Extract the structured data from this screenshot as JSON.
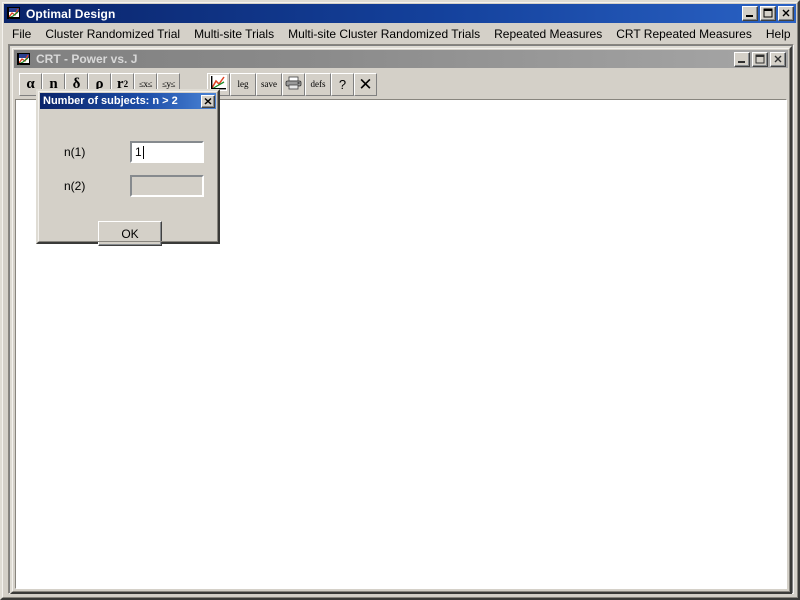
{
  "app": {
    "title": "Optimal Design",
    "icon": "chart-icon",
    "window_buttons": [
      {
        "name": "minimize",
        "glyph": "minimize-icon"
      },
      {
        "name": "maximize",
        "glyph": "maximize-icon"
      },
      {
        "name": "close",
        "glyph": "close-icon"
      }
    ]
  },
  "menubar": {
    "items": [
      {
        "label": "File"
      },
      {
        "label": "Cluster Randomized Trial"
      },
      {
        "label": "Multi-site Trials"
      },
      {
        "label": "Multi-site Cluster Randomized Trials"
      },
      {
        "label": "Repeated Measures"
      },
      {
        "label": "CRT Repeated Measures"
      },
      {
        "label": "Help"
      }
    ]
  },
  "child_window": {
    "title": "CRT - Power vs. J",
    "icon": "chart-icon",
    "window_buttons": [
      {
        "name": "minimize",
        "glyph": "minimize-icon"
      },
      {
        "name": "maximize",
        "glyph": "maximize-icon"
      },
      {
        "name": "close",
        "glyph": "close-icon"
      }
    ],
    "toolbar": {
      "group_one": [
        {
          "name": "alpha-button",
          "label": "α"
        },
        {
          "name": "n-button",
          "label": "n"
        },
        {
          "name": "delta-button",
          "label": "δ"
        },
        {
          "name": "rho-button",
          "label": "ρ"
        },
        {
          "name": "r2-button",
          "label": "r",
          "sub": "2"
        },
        {
          "name": "x-range-button",
          "label": "≤x≤"
        },
        {
          "name": "y-range-button",
          "label": "≤y≤"
        }
      ],
      "group_two": [
        {
          "name": "plot-button",
          "label": "",
          "icon": "line-chart-icon"
        },
        {
          "name": "legend-button",
          "label": "leg"
        },
        {
          "name": "save-button",
          "label": "save"
        },
        {
          "name": "print-button",
          "label": "",
          "icon": "printer-icon"
        },
        {
          "name": "defaults-button",
          "label": "defs"
        },
        {
          "name": "help-button",
          "label": "?"
        },
        {
          "name": "close-plot-button",
          "label": "✕"
        }
      ]
    }
  },
  "dialog": {
    "title": "Number of subjects: n > 2",
    "close_label": "✕",
    "fields": [
      {
        "name": "n1",
        "label": "n(1)",
        "value": "1",
        "placeholder": "",
        "disabled": false
      },
      {
        "name": "n2",
        "label": "n(2)",
        "value": "",
        "placeholder": "",
        "disabled": true
      }
    ],
    "ok_label": "OK"
  },
  "colors": {
    "titlebar_start": "#0a246a",
    "titlebar_end": "#2a62c4",
    "face": "#d4d0c8",
    "mdi_background": "#808080",
    "plot_background": "#ffffff",
    "inactive_titlebar": "#808080"
  }
}
